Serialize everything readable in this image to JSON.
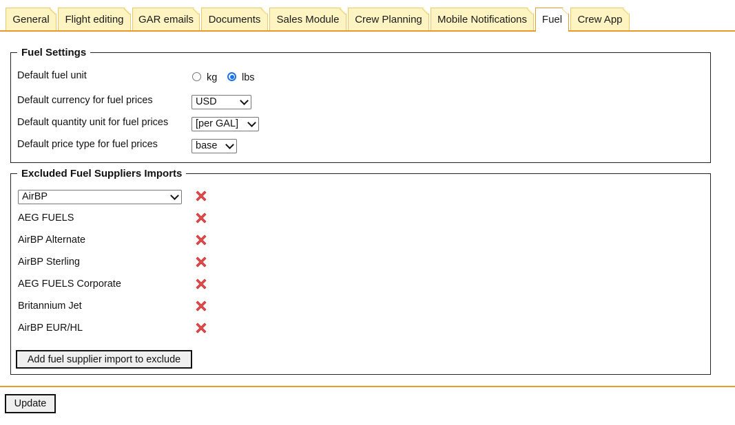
{
  "tabs": [
    {
      "label": "General",
      "active": false
    },
    {
      "label": "Flight editing",
      "active": false
    },
    {
      "label": "GAR emails",
      "active": false
    },
    {
      "label": "Documents",
      "active": false
    },
    {
      "label": "Sales Module",
      "active": false
    },
    {
      "label": "Crew Planning",
      "active": false
    },
    {
      "label": "Mobile Notifications",
      "active": false
    },
    {
      "label": "Fuel",
      "active": true
    },
    {
      "label": "Crew App",
      "active": false
    }
  ],
  "fuel_settings": {
    "legend": "Fuel Settings",
    "unit_label": "Default fuel unit",
    "unit_options": [
      {
        "label": "kg",
        "checked": false
      },
      {
        "label": "lbs",
        "checked": true
      }
    ],
    "currency_label": "Default currency for fuel prices",
    "currency_value": "USD",
    "quantity_label": "Default quantity unit for fuel prices",
    "quantity_value": "[per GAL]",
    "price_type_label": "Default price type for fuel prices",
    "price_type_value": "base"
  },
  "excluded_suppliers": {
    "legend": "Excluded Fuel Suppliers Imports",
    "select_value": "AirBP",
    "items": [
      "AEG FUELS",
      "AirBP Alternate",
      "AirBP Sterling",
      "AEG FUELS Corporate",
      "Britannium Jet",
      "AirBP EUR/HL"
    ],
    "add_button_label": "Add fuel supplier import to exclude"
  },
  "update_button_label": "Update",
  "colors": {
    "tab_bg": "#fdf4c2",
    "accent": "#e69a28",
    "radio": "#1a73e8",
    "delete": "#e34b4b"
  }
}
